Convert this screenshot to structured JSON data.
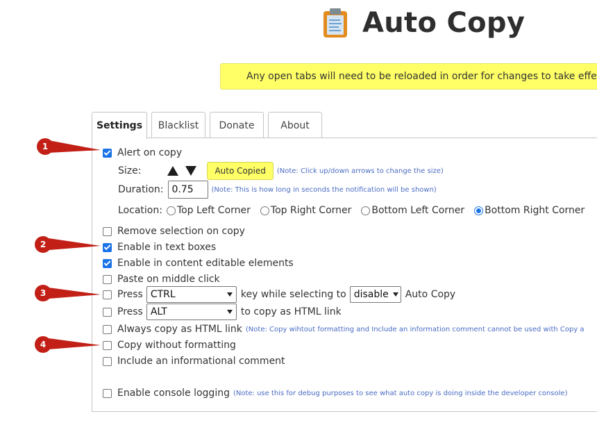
{
  "app": {
    "title": "Auto Copy"
  },
  "notice": "Any open tabs will need to be reloaded in order for changes to take effect.",
  "tabs": [
    {
      "label": "Settings",
      "active": true
    },
    {
      "label": "Blacklist",
      "active": false
    },
    {
      "label": "Donate",
      "active": false
    },
    {
      "label": "About",
      "active": false
    }
  ],
  "settings": {
    "alert_on_copy": {
      "label": "Alert on copy",
      "checked": true
    },
    "size": {
      "label": "Size:",
      "preview": "Auto Copied",
      "note": "(Note: Click up/down arrows to change the size)"
    },
    "duration": {
      "label": "Duration:",
      "value": "0.75",
      "note": "(Note: This is how long in seconds the notification will be shown)"
    },
    "location": {
      "label": "Location:",
      "options": [
        "Top Left Corner",
        "Top Right Corner",
        "Bottom Left Corner",
        "Bottom Right Corner"
      ],
      "selected": "Bottom Right Corner"
    },
    "remove_selection": {
      "label": "Remove selection on copy",
      "checked": false
    },
    "enable_text_boxes": {
      "label": "Enable in text boxes",
      "checked": true
    },
    "enable_content_editable": {
      "label": "Enable in content editable elements",
      "checked": true
    },
    "paste_middle_click": {
      "label": "Paste on middle click",
      "checked": false
    },
    "press_key": {
      "label": "Press",
      "key": "CTRL",
      "middle": "key while selecting to",
      "action": "disable",
      "suffix": "Auto Copy",
      "checked": false
    },
    "press_alt": {
      "label": "Press",
      "key": "ALT",
      "suffix": "to copy as HTML link",
      "checked": false
    },
    "always_html_link": {
      "label": "Always copy as HTML link",
      "note": "(Note: Copy wihtout formatting and Include an information comment cannot be used with Copy a",
      "checked": false
    },
    "copy_without_formatting": {
      "label": "Copy without formatting",
      "checked": false
    },
    "informational_comment": {
      "label": "Include an informational comment",
      "checked": false
    },
    "console_logging": {
      "label": "Enable console logging",
      "note": "(Note: use this for debug purposes to see what auto copy is doing inside the developer console)",
      "checked": false
    }
  },
  "markers": [
    "1",
    "2",
    "3",
    "4"
  ],
  "colors": {
    "notice_bg": "#ffff66",
    "check_blue": "#1a73e8",
    "marker_red": "#c21f16",
    "note_blue": "#4a6cc3"
  },
  "icons": {
    "logo": "clipboard-icon",
    "size_up": "arrow-up-icon",
    "size_down": "arrow-down-icon",
    "select": "caret-down-icon"
  }
}
